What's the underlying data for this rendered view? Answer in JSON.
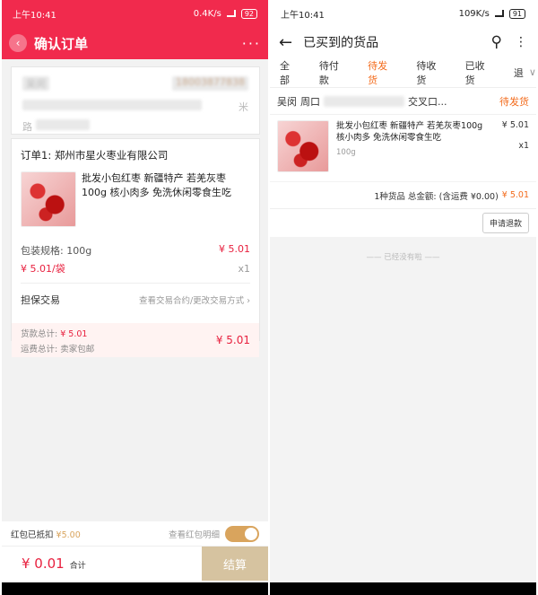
{
  "left": {
    "status": {
      "time": "上午10:41",
      "speed": "0.4K/s",
      "battery": "92"
    },
    "header": {
      "title": "确认订单",
      "more": "···"
    },
    "address": {
      "name": "吴闵",
      "phone": "18003877838",
      "line1": "米",
      "line2": "路"
    },
    "order": {
      "shop": "订单1: 郑州市星火枣业有限公司",
      "item_name": "批发小包红枣 新疆特产 若羌灰枣100g 核小肉多 免洗休闲零食生吃",
      "spec_label": "包装规格: 100g",
      "unit_price": "¥ 5.01/袋",
      "price": "¥ 5.01",
      "qty": "x1",
      "guarantee_label": "担保交易",
      "guarantee_link": "查看交易合约/更改交易方式",
      "goods_total_label": "货款总计:",
      "goods_total": "¥ 5.01",
      "shipping_label": "运费总计:",
      "shipping_value": "卖家包邮",
      "grand_total": "¥ 5.01"
    },
    "redpacket": {
      "label": "红包已抵扣",
      "value": "¥5.00",
      "link": "查看红包明细"
    },
    "pay": {
      "amount": "¥ 0.01",
      "total_label": "合计",
      "button": "结算"
    }
  },
  "right": {
    "status": {
      "time": "上午10:41",
      "speed": "109K/s",
      "battery": "91"
    },
    "header": {
      "title": "已买到的货品"
    },
    "tabs": [
      "全部",
      "待付款",
      "待发货",
      "待收货",
      "已收货",
      "退"
    ],
    "active_tab": 2,
    "order": {
      "buyer": "吴闵",
      "address_start": "周口",
      "address_end": "交叉口...",
      "status": "待发货",
      "item_name": "批发小包红枣 新疆特产 若羌灰枣100g 核小肉多 免洗休闲零食生吃",
      "item_spec": "100g",
      "price": "¥ 5.01",
      "qty": "x1",
      "summary": "1种货品 总金额: (含运费 ¥0.00)",
      "total": "¥ 5.01",
      "refund_button": "申请退款"
    },
    "no_more": "已经没有啦"
  },
  "colors": {
    "brand_red": "#f12a4d",
    "price_red": "#e8213f",
    "accent_orange": "#f36b1c",
    "gold": "#d9a45d"
  }
}
